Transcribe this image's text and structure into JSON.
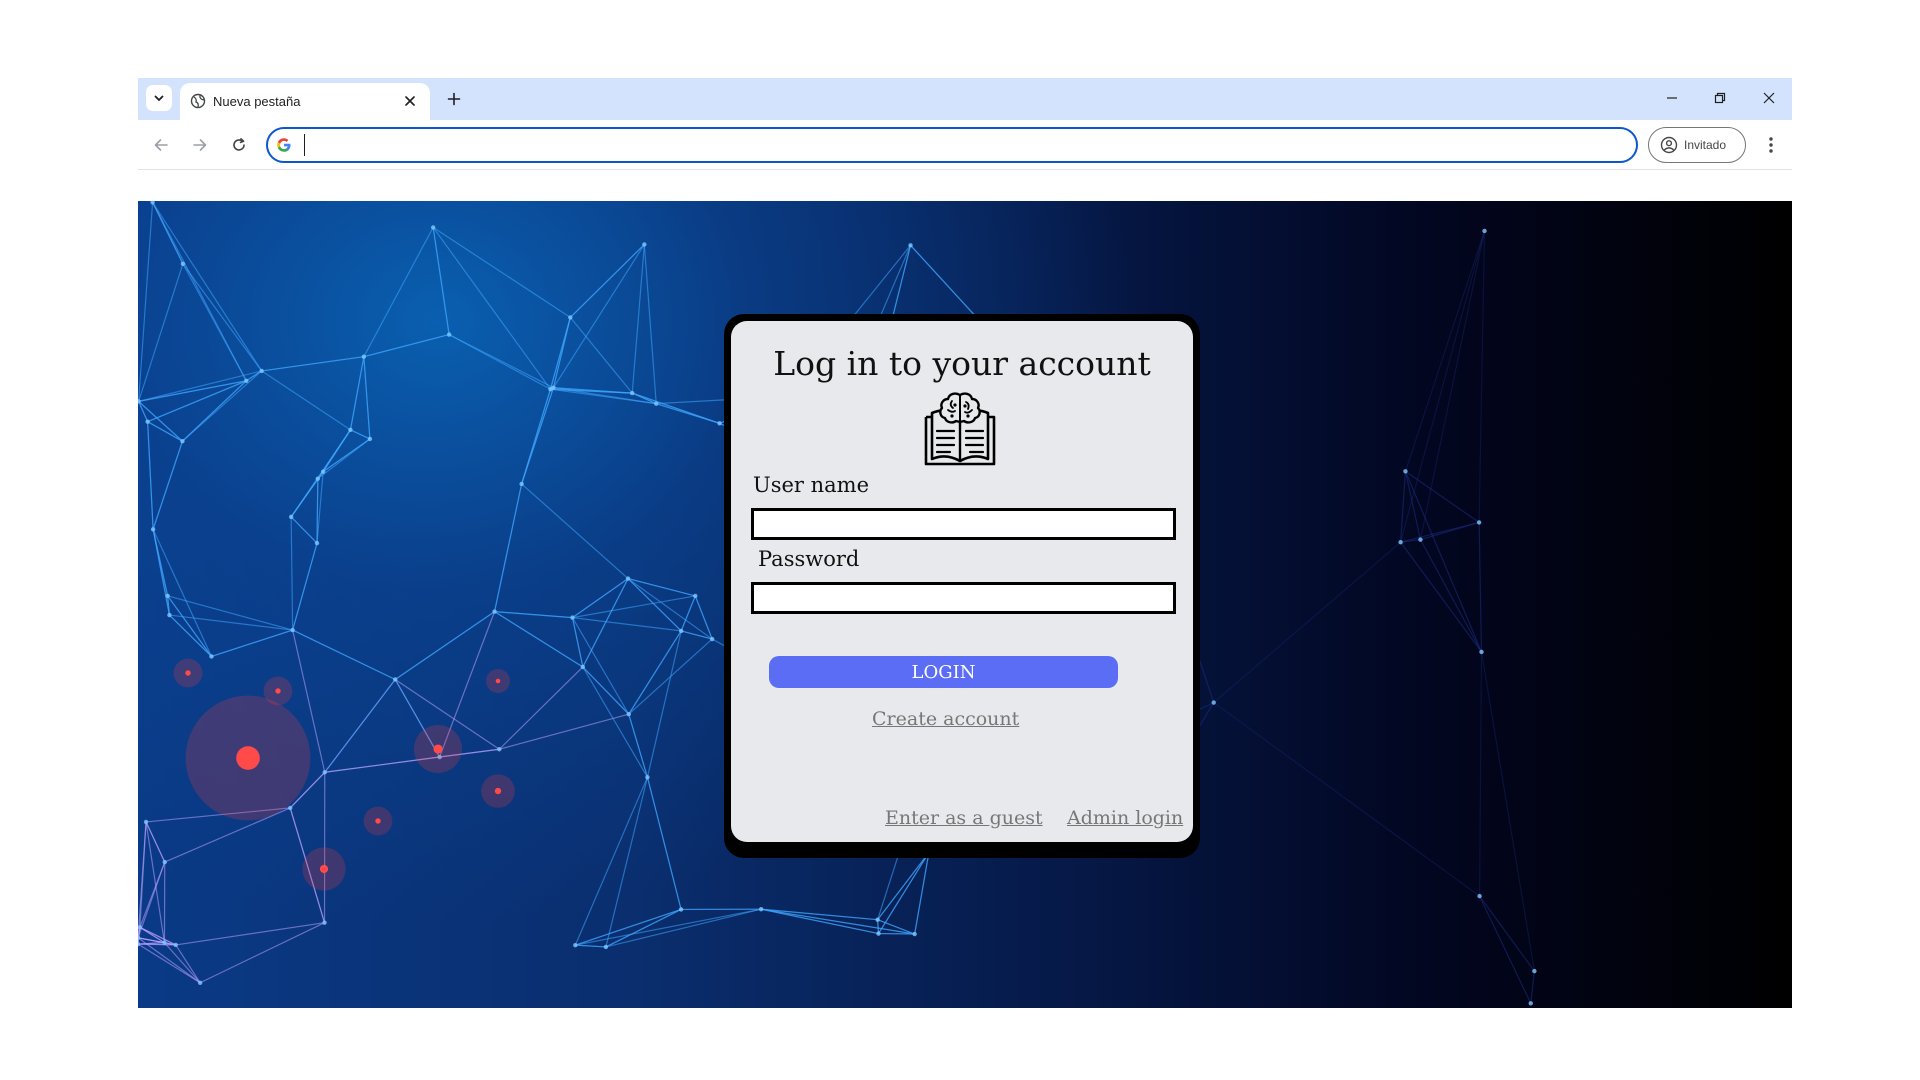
{
  "browser": {
    "tab_title": "Nueva pestaña",
    "address_value": "",
    "profile_label": "Invitado",
    "accent_color": "#0b57d0",
    "tabstrip_color": "#d3e3fd"
  },
  "login_card": {
    "title": "Log in to your account",
    "icon": "brain-book-icon",
    "username_label": "User name",
    "username_value": "",
    "password_label": "Password",
    "password_value": "",
    "login_button": "LOGIN",
    "login_button_color": "#5b6cf5",
    "create_account_link": "Create account",
    "guest_link": "Enter as a guest",
    "admin_link": "Admin login"
  }
}
